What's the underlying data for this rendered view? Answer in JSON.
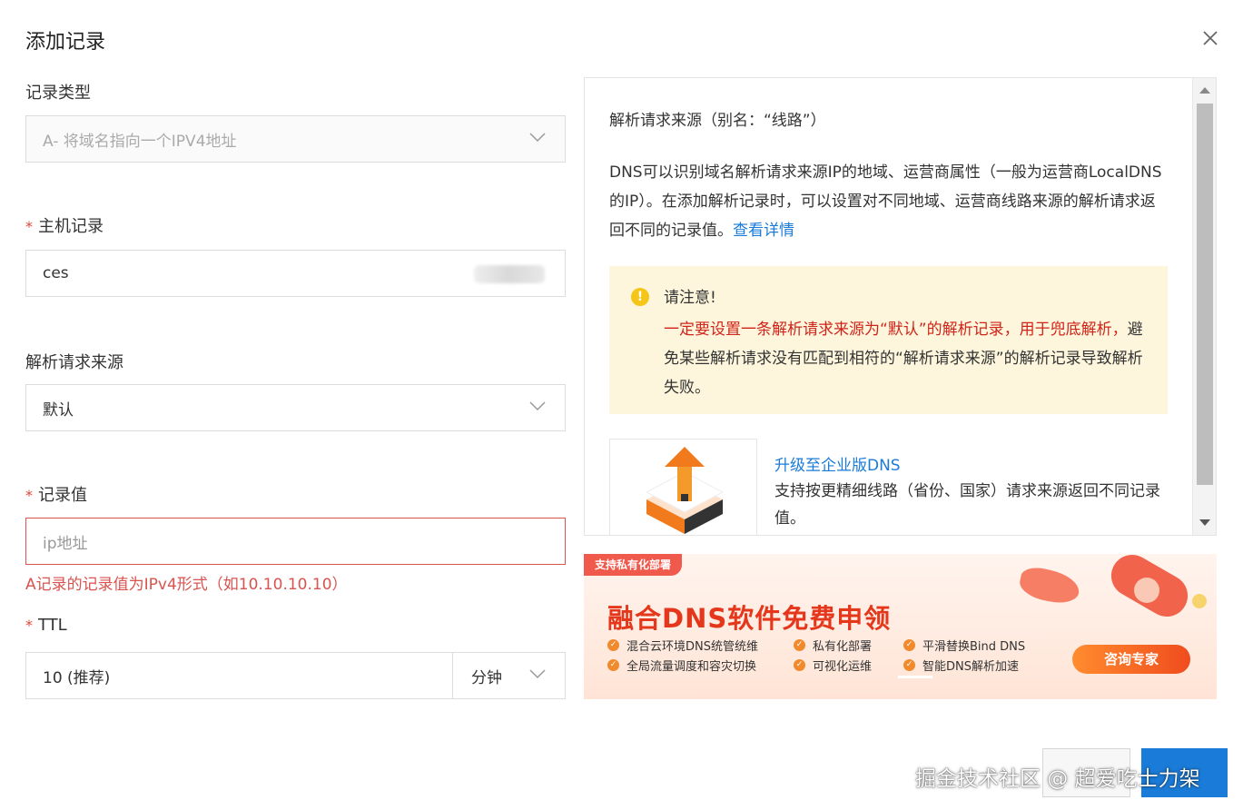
{
  "dialog": {
    "title": "添加记录"
  },
  "form": {
    "record_type": {
      "label": "记录类型",
      "value": "A- 将域名指向一个IPV4地址"
    },
    "host_record": {
      "required_mark": "*",
      "label": "主机记录",
      "value": "ces"
    },
    "resolve_source": {
      "label": "解析请求来源",
      "value": "默认"
    },
    "record_value": {
      "required_mark": "*",
      "label": "记录值",
      "placeholder": "ip地址",
      "error": "A记录的记录值为IPv4形式（如10.10.10.10）"
    },
    "ttl": {
      "required_mark": "*",
      "label": "TTL",
      "value": "10 (推荐)",
      "unit": "分钟"
    }
  },
  "help": {
    "heading": "解析请求来源（别名：“线路”）",
    "para": "DNS可以识别域名解析请求来源IP的地域、运营商属性（一般为运营商LocalDNS的IP）。在添加解析记录时，可以设置对不同地域、运营商线路来源的解析请求返回不同的记录值。",
    "para_link": "查看详情",
    "notice": {
      "icon": "!",
      "title": "请注意!",
      "body_red": "一定要设置一条解析请求来源为“默认”的解析记录，用于兜底解析，",
      "body_rest": "避免某些解析请求没有匹配到相符的“解析请求来源”的解析记录导致解析失败。"
    },
    "upgrade": {
      "title": "升级至企业版DNS",
      "desc": "支持按更精细线路（省份、国家）请求来源返回不同记录值。"
    }
  },
  "banner": {
    "tag": "支持私有化部署",
    "title": "融合DNS软件免费申领",
    "features": [
      "混合云环境DNS统管统维",
      "私有化部署",
      "平滑替换Bind DNS",
      "全局流量调度和容灾切换",
      "可视化运维",
      "智能DNS解析加速"
    ],
    "cta": "咨询专家"
  },
  "watermark": "掘金技术社区 @ 超爱吃士力架",
  "colors": {
    "primary": "#1a7bd8",
    "error": "#d9534f",
    "notice_bg": "#fdf6dc",
    "banner_red": "#e5371c"
  }
}
